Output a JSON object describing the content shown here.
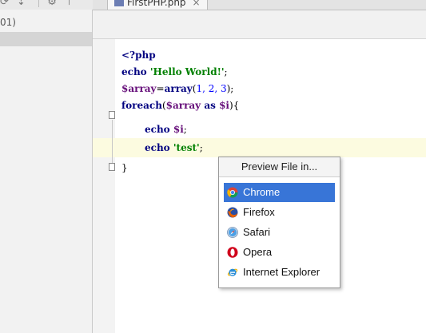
{
  "toolbar": {
    "glyphs": [
      "⟳",
      "⇣",
      "⚙",
      "⊤"
    ]
  },
  "project_panel": {
    "row_label": "01)"
  },
  "tab": {
    "label": "FirstPHP.php",
    "close_glyph": "×"
  },
  "code": {
    "line1": "<?php",
    "line2_kw": "echo",
    "line2_str": "'Hello World!'",
    "line2_end": ";",
    "line3_var": "$array",
    "line3_eq": "=",
    "line3_fn": "array",
    "line3_open": "(",
    "line3_nums": "1, 2, 3",
    "line3_end": ");",
    "line4_kw": "foreach",
    "line4_open": "(",
    "line4_var": "$array",
    "line4_as": "as",
    "line4_var2": "$i",
    "line4_end": "){",
    "line5_kw": "echo",
    "line5_var": "$i",
    "line5_end": ";",
    "line6_kw": "echo",
    "line6_str": "'test'",
    "line6_end": ";",
    "line7": "}"
  },
  "popup": {
    "title": "Preview File in...",
    "items": [
      {
        "label": "Chrome",
        "icon": "chrome-icon",
        "selected": true
      },
      {
        "label": "Firefox",
        "icon": "firefox-icon",
        "selected": false
      },
      {
        "label": "Safari",
        "icon": "safari-icon",
        "selected": false
      },
      {
        "label": "Opera",
        "icon": "opera-icon",
        "selected": false
      },
      {
        "label": "Internet Explorer",
        "icon": "internet-explorer-icon",
        "selected": false
      }
    ]
  },
  "colors": {
    "selection": "#3875d7",
    "current_line": "#fcfbe0",
    "keyword": "#000080",
    "string": "#008000",
    "variable": "#660e7a",
    "number": "#0000ff"
  }
}
